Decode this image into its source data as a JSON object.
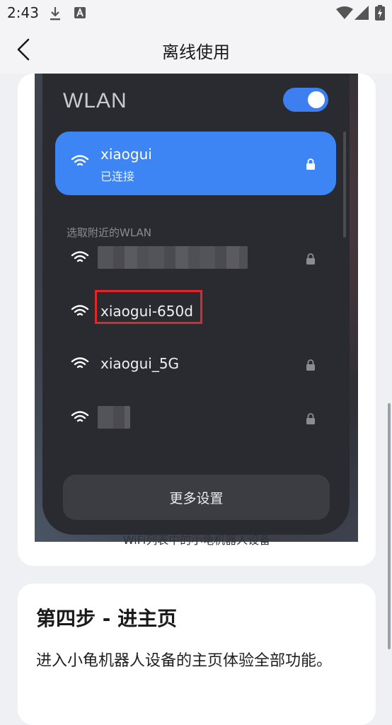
{
  "status_bar": {
    "time": "2:43"
  },
  "header": {
    "title": "离线使用"
  },
  "card1": {
    "screenshot": {
      "wlan_title": "WLAN",
      "connected": {
        "ssid": "xiaogui",
        "status": "已连接"
      },
      "nearby_label": "选取附近的WLAN",
      "networks": [
        "xiaogui-650d",
        "xiaogui_5G"
      ],
      "more_button": "更多设置"
    },
    "caption": "WiFi列表中的小龟机器人设备"
  },
  "card2": {
    "title": "第四步 - 进主页",
    "description": "进入小龟机器人设备的主页体验全部功能。"
  },
  "colors": {
    "accent": "#3d84f4",
    "highlight": "#e3262a"
  }
}
